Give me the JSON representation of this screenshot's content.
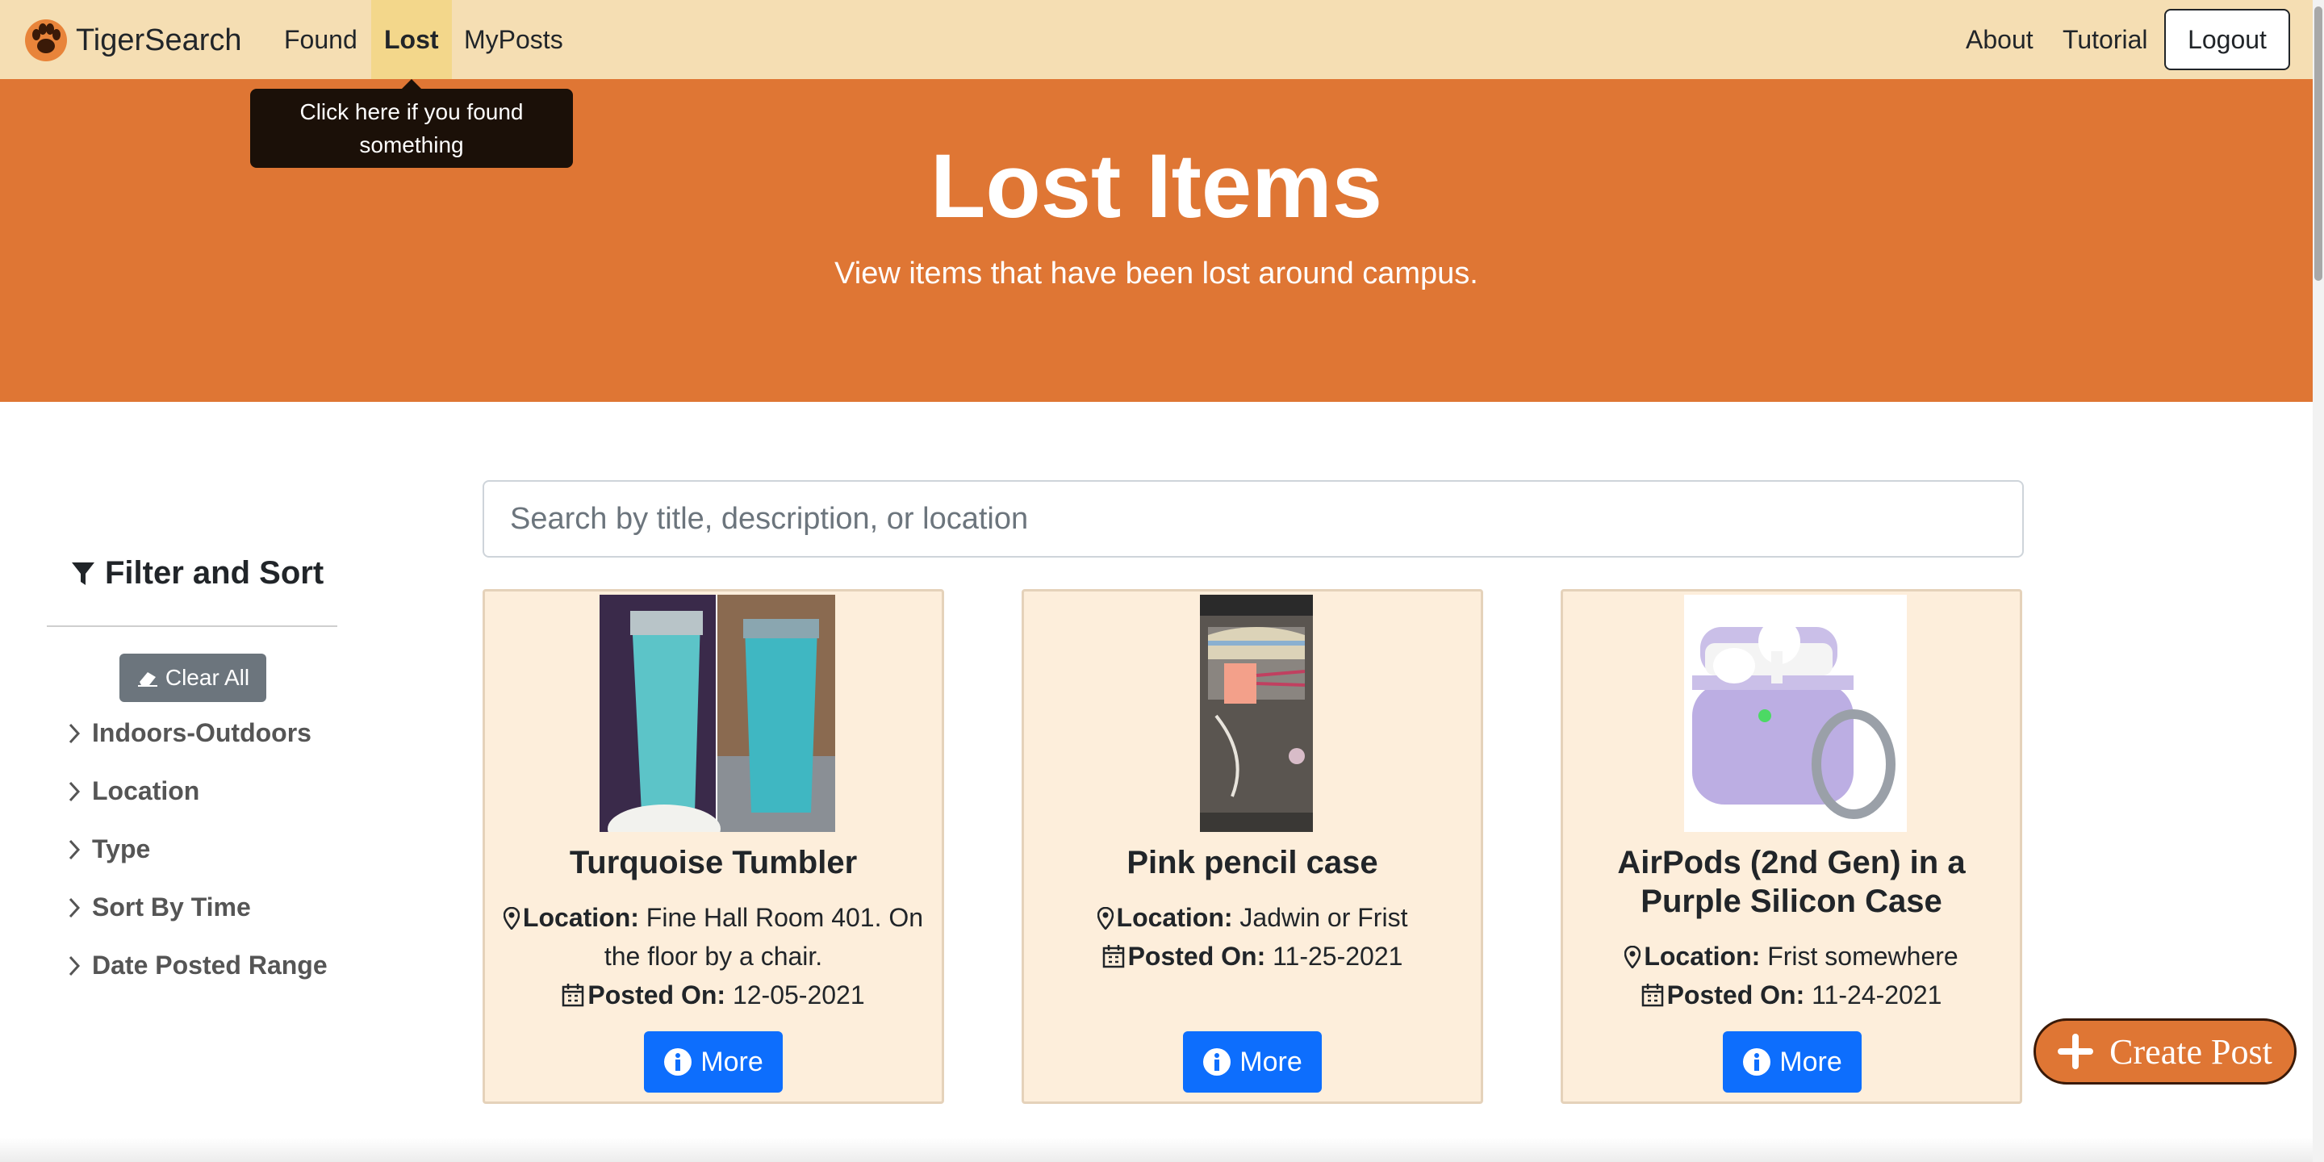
{
  "navbar": {
    "brand": "TigerSearch",
    "links": [
      "Found",
      "Lost",
      "MyPosts"
    ],
    "right_links": [
      "About",
      "Tutorial"
    ],
    "logout": "Logout",
    "active": "Lost"
  },
  "tooltip": {
    "text": "Click here if you found something"
  },
  "hero": {
    "title": "Lost Items",
    "subtitle": "View items that have been lost around campus."
  },
  "search": {
    "placeholder": "Search by title, description, or location",
    "value": ""
  },
  "sidebar": {
    "title": "Filter and Sort",
    "clear_label": "Clear All",
    "filters": [
      "Indoors-Outdoors",
      "Location",
      "Type",
      "Sort By Time",
      "Date Posted Range"
    ]
  },
  "cards": [
    {
      "title": "Turquoise Tumbler",
      "location_label": "Location:",
      "location": "Fine Hall Room 401. On the floor by a chair.",
      "posted_label": "Posted On:",
      "posted": "12-05-2021",
      "more": "More"
    },
    {
      "title": "Pink pencil case",
      "location_label": "Location:",
      "location": "Jadwin or Frist",
      "posted_label": "Posted On:",
      "posted": "11-25-2021",
      "more": "More"
    },
    {
      "title": "AirPods (2nd Gen) in a Purple Silicon Case",
      "location_label": "Location:",
      "location": "Frist somewhere",
      "posted_label": "Posted On:",
      "posted": "11-24-2021",
      "more": "More"
    }
  ],
  "create_post": "Create Post",
  "colors": {
    "navbar": "#f5deb3",
    "hero": "#df7634",
    "card_bg": "#fdeedb",
    "primary": "#0d6efd",
    "secondary": "#6c757d"
  },
  "icons": [
    "paw-logo-icon",
    "filter-icon",
    "eraser-icon",
    "chevron-right-icon",
    "map-marker-icon",
    "calendar-icon",
    "info-circle-icon",
    "plus-icon"
  ]
}
